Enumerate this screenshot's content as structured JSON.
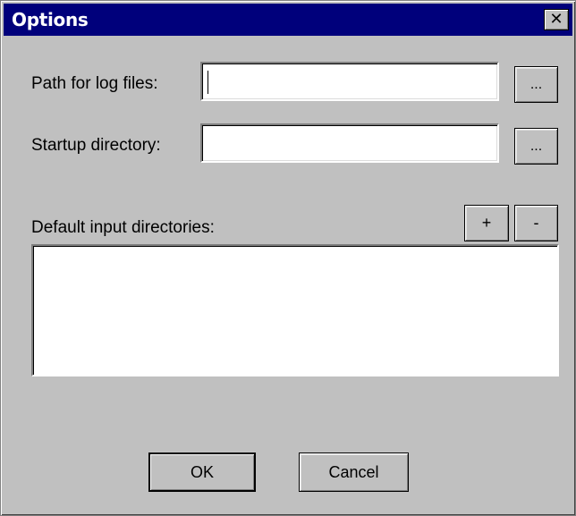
{
  "dialog": {
    "title": "Options",
    "close_glyph": "✕"
  },
  "log_path": {
    "label": "Path for log files:",
    "value": "",
    "browse_label": "..."
  },
  "startup_dir": {
    "label": "Startup directory:",
    "value": "",
    "browse_label": "..."
  },
  "input_dirs": {
    "label": "Default input directories:",
    "add_label": "+",
    "remove_label": "-",
    "items": []
  },
  "footer": {
    "ok_label": "OK",
    "cancel_label": "Cancel"
  },
  "colors": {
    "titlebar": "#00007b",
    "face": "#c0c0c0"
  }
}
